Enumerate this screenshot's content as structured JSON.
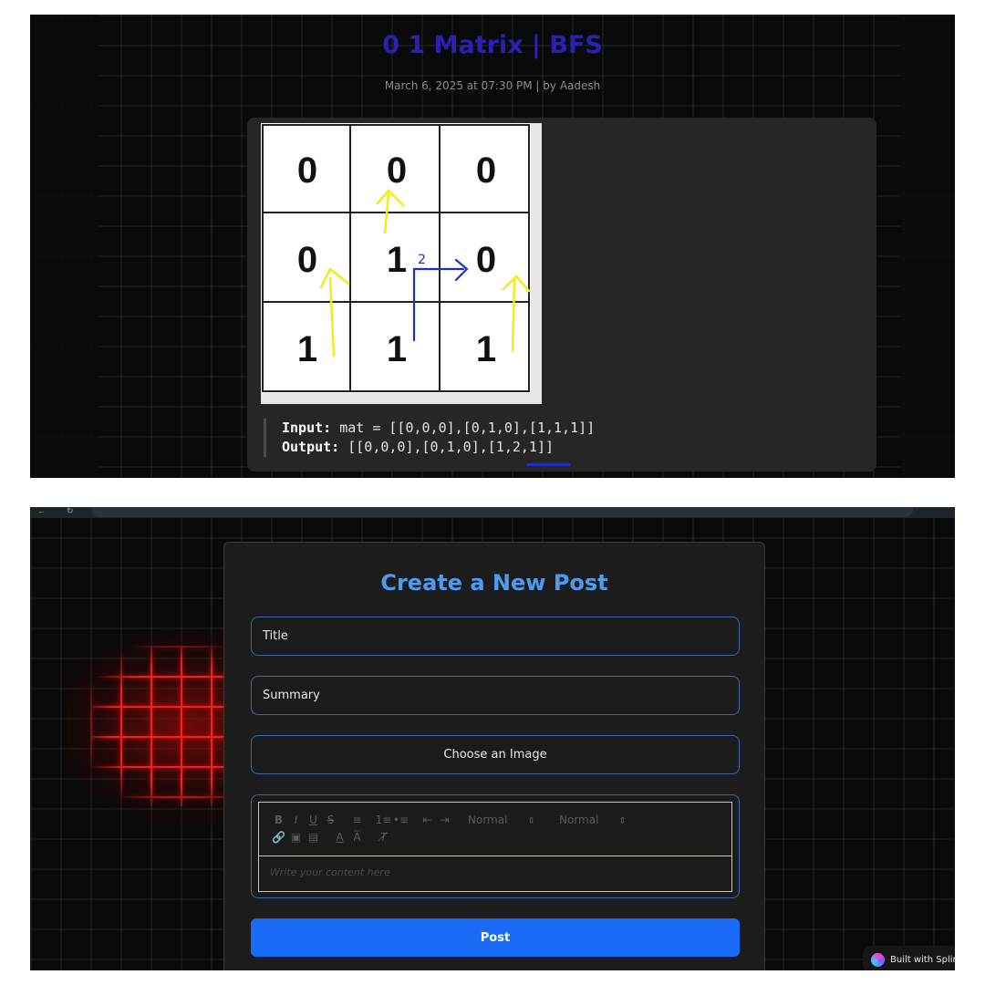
{
  "top_post": {
    "title": "0 1 Matrix | BFS",
    "meta": "March 6, 2025 at 07:30 PM | by Aadesh",
    "matrix_figure": {
      "rows": [
        [
          "0",
          "0",
          "0"
        ],
        [
          "0",
          "1",
          "0"
        ],
        [
          "1",
          "1",
          "1"
        ]
      ],
      "annotation_label": "2"
    },
    "example": {
      "input_label": "Input:",
      "input_value": " mat = [[0,0,0],[0,1,0],[1,1,1]]",
      "output_label": "Output:",
      "output_value": " [[0,0,0],[0,1,0],[1,2,1]]"
    }
  },
  "form": {
    "title": "Create a New Post",
    "title_placeholder": "Title",
    "summary_placeholder": "Summary",
    "image_button": "Choose an Image",
    "toolbar": {
      "row1": [
        "B",
        "I",
        "U",
        "S",
        "≡",
        "1≡",
        "•≡",
        "⇤",
        "⇥"
      ],
      "header_select": "Normal",
      "size_select": "Normal",
      "row2": [
        "🔗",
        "▣",
        "▤",
        "A",
        "A̅",
        "T̸"
      ]
    },
    "editor_placeholder": "Write your content here",
    "submit": "Post"
  },
  "badge": {
    "text": "Built with Splin"
  },
  "colors": {
    "title_blue": "#2a1fb6",
    "form_title": "#4d9cf2",
    "button_blue": "#1a6bf5",
    "red_glow": "#ff1e1e"
  }
}
